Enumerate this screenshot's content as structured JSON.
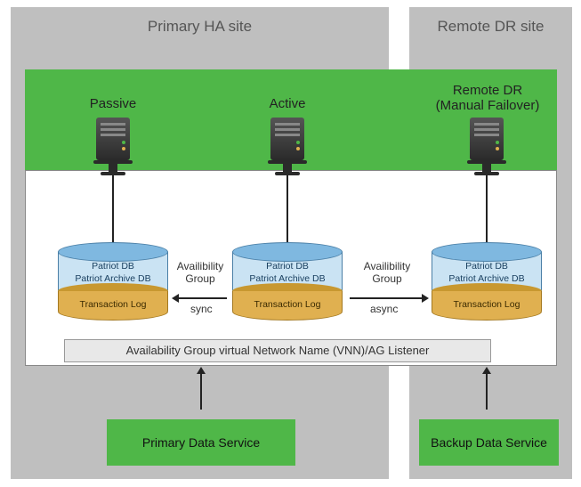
{
  "sites": {
    "primary_title": "Primary HA site",
    "remote_title": "Remote DR site"
  },
  "nodes": {
    "passive_label": "Passive",
    "active_label": "Active",
    "remote_label_line1": "Remote DR",
    "remote_label_line2": "(Manual Failover)"
  },
  "db": {
    "line1": "Patriot DB",
    "line2": "Patriot Archive DB",
    "tlog": "Transaction Log"
  },
  "links": {
    "avail_label_1": "Availibility",
    "avail_label_2": "Group",
    "sync": "sync",
    "async": "async"
  },
  "vnn": "Availability Group virtual Network Name (VNN)/AG Listener",
  "services": {
    "primary": "Primary Data Service",
    "backup": "Backup Data Service"
  }
}
